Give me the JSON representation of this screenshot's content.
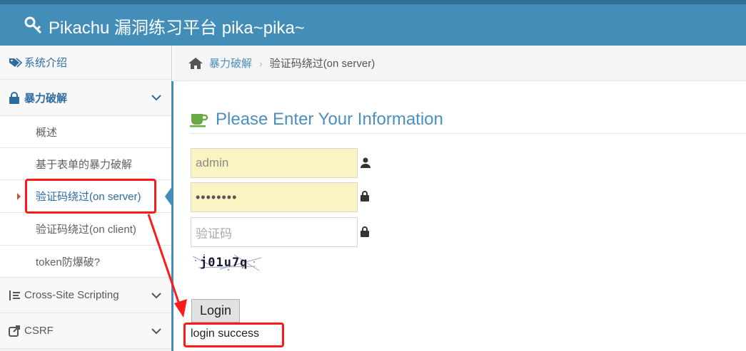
{
  "header": {
    "title": "Pikachu 漏洞练习平台 pika~pika~"
  },
  "sidebar": {
    "items": [
      {
        "label": "系统介绍",
        "icon": "tags-icon"
      },
      {
        "label": "暴力破解",
        "icon": "lock-icon"
      },
      {
        "label": "Cross-Site Scripting",
        "icon": "list-icon"
      },
      {
        "label": "CSRF",
        "icon": "share-icon"
      }
    ],
    "subitems": [
      "概述",
      "基于表单的暴力破解",
      "验证码绕过(on server)",
      "验证码绕过(on client)",
      "token防爆破?"
    ]
  },
  "breadcrumb": {
    "parent": "暴力破解",
    "separator": "›",
    "current": "验证码绕过(on server)"
  },
  "form": {
    "heading": "Please Enter Your Information",
    "username_value": "admin",
    "password_value": "••••••••",
    "captcha_placeholder": "验证码",
    "captcha_text": "j01u7q",
    "login_label": "Login",
    "result_text": "login success"
  },
  "colors": {
    "header_bg": "#438eb9",
    "link": "#4c8fbd",
    "annotation": "#ff1a1a",
    "autofill": "#fbf3c1"
  }
}
